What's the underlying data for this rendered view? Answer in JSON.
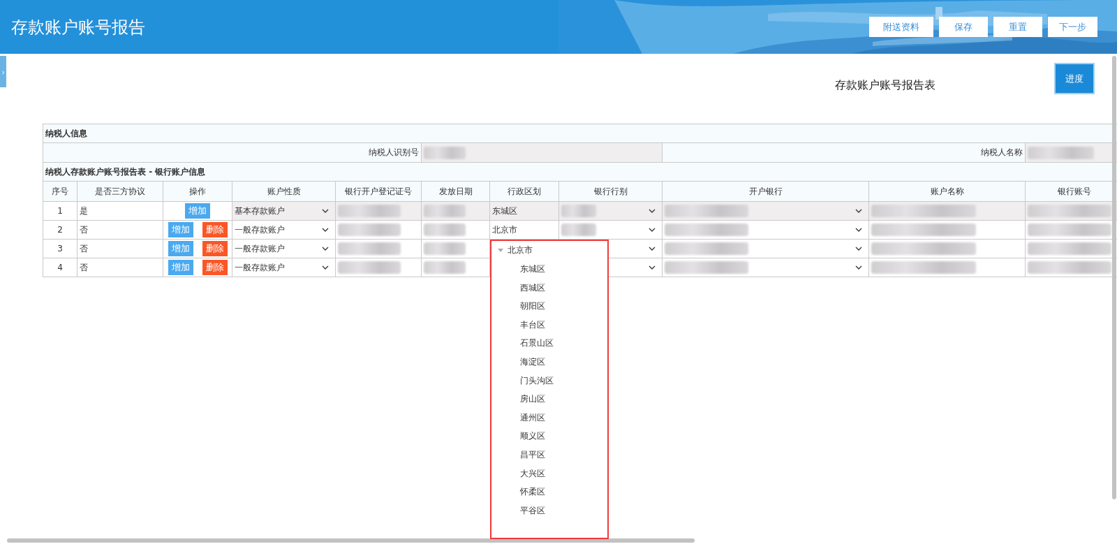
{
  "header": {
    "title": "存款账户账号报告",
    "buttons": [
      "附送资料",
      "保存",
      "重置",
      "下一步"
    ]
  },
  "sidebar_toggle": "›",
  "progress_button": "进度",
  "report_title": "存款账户账号报告表",
  "taxpayer_section": {
    "heading": "纳税人信息",
    "id_label": "纳税人识别号",
    "name_label": "纳税人名称"
  },
  "accounts_section": {
    "heading": "纳税人存款账户账号报告表 - 银行账户信息",
    "columns": [
      "序号",
      "是否三方协议",
      "操作",
      "账户性质",
      "银行开户登记证号",
      "发放日期",
      "行政区划",
      "银行行别",
      "开户银行",
      "账户名称",
      "银行账号"
    ],
    "rows": [
      {
        "index": "1",
        "tripartite": "是",
        "actions": [
          {
            "label": "增加",
            "kind": "add"
          }
        ],
        "account_type": "基本存款账户",
        "region": "东城区",
        "readonly": true
      },
      {
        "index": "2",
        "tripartite": "否",
        "actions": [
          {
            "label": "增加",
            "kind": "add"
          },
          {
            "label": "删除",
            "kind": "delete"
          }
        ],
        "account_type": "一般存款账户",
        "region": "北京市",
        "readonly": false
      },
      {
        "index": "3",
        "tripartite": "否",
        "actions": [
          {
            "label": "增加",
            "kind": "add"
          },
          {
            "label": "删除",
            "kind": "delete"
          }
        ],
        "account_type": "一般存款账户",
        "readonly": false
      },
      {
        "index": "4",
        "tripartite": "否",
        "actions": [
          {
            "label": "增加",
            "kind": "add"
          },
          {
            "label": "删除",
            "kind": "delete"
          }
        ],
        "account_type": "一般存款账户",
        "readonly": false
      }
    ]
  },
  "region_dropdown": {
    "label": "北京市",
    "expanded": true,
    "children": [
      {
        "label": "东城区"
      },
      {
        "label": "西城区"
      },
      {
        "label": "朝阳区"
      },
      {
        "label": "丰台区"
      },
      {
        "label": "石景山区"
      },
      {
        "label": "海淀区"
      },
      {
        "label": "门头沟区"
      },
      {
        "label": "房山区"
      },
      {
        "label": "通州区"
      },
      {
        "label": "顺义区"
      },
      {
        "label": "昌平区"
      },
      {
        "label": "大兴区"
      },
      {
        "label": "怀柔区"
      },
      {
        "label": "平谷区"
      }
    ]
  }
}
